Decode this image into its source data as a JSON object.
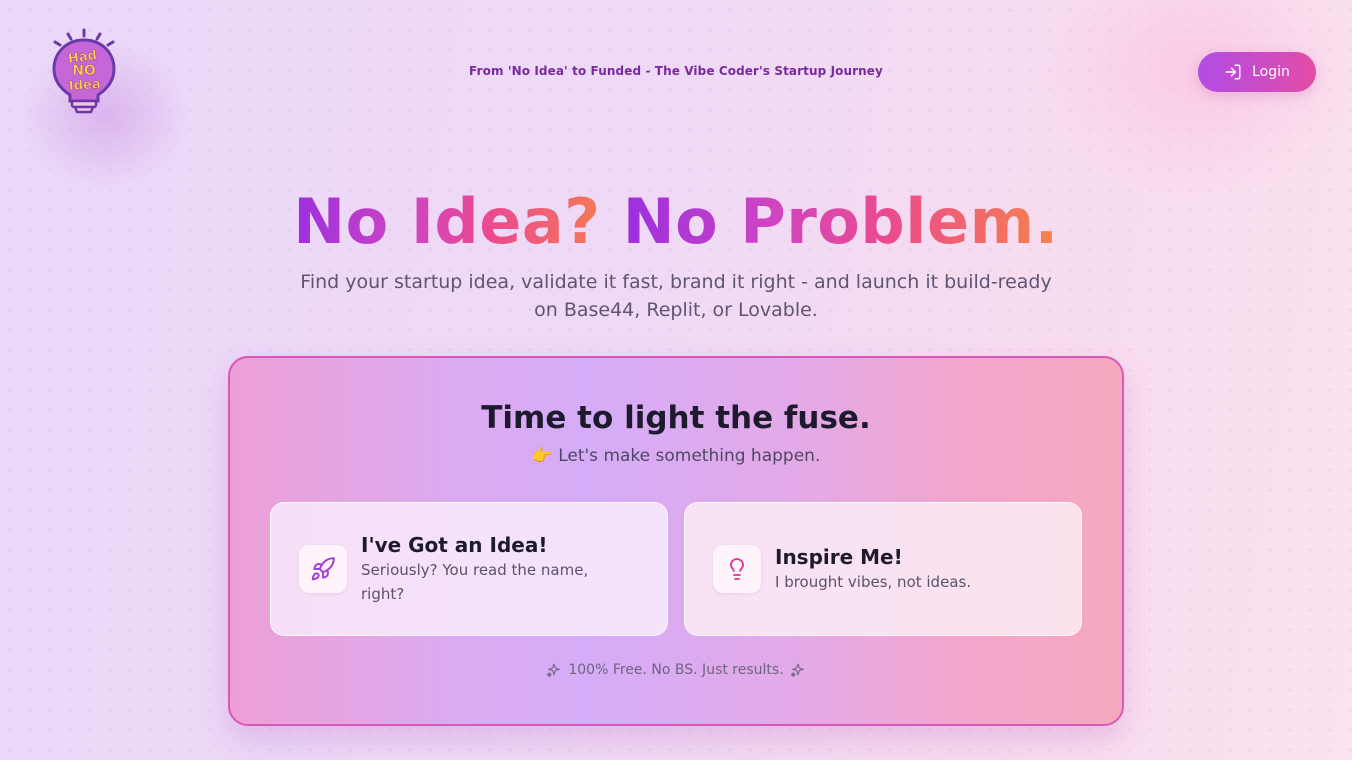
{
  "brand": {
    "logo_text": [
      "Had",
      "NO",
      "Idea"
    ],
    "tagline": "From 'No Idea' to Funded - The Vibe Coder's Startup Journey"
  },
  "header": {
    "login_label": "Login",
    "login_icon": "login-arrow-icon"
  },
  "hero": {
    "headline_part1": "No Idea? ",
    "headline_part2": "No Problem.",
    "subheadline": "Find your startup idea, validate it fast, brand it right - and launch it build-ready on Base44, Replit, or Lovable."
  },
  "card": {
    "title": "Time to light the fuse.",
    "subtitle": "👉 Let's make something happen.",
    "options": [
      {
        "title": "I've Got an Idea!",
        "description": "Seriously? You read the name, right?",
        "icon": "rocket-icon"
      },
      {
        "title": "Inspire Me!",
        "description": "I brought vibes, not ideas.",
        "icon": "lightbulb-icon"
      }
    ],
    "footer_note": "100% Free. No BS. Just results."
  },
  "colors": {
    "accent_purple": "#9b2fe0",
    "accent_pink": "#e44ca7",
    "accent_orange": "#f7834a",
    "logo_yellow": "#ffd84a"
  }
}
